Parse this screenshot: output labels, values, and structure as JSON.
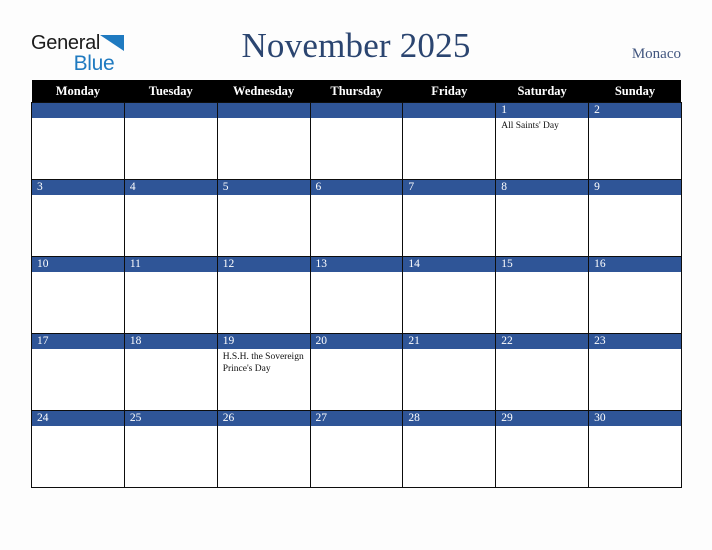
{
  "brand": {
    "name_part1": "General",
    "name_part2": "Blue",
    "triangle_icon": "blue-triangle-icon"
  },
  "header": {
    "title": "November 2025",
    "country": "Monaco"
  },
  "colors": {
    "header_row_bg": "#000000",
    "date_band_bg": "#2f5597",
    "title_text": "#2b4570",
    "country_text": "#42567f",
    "brand_blue": "#1f7ac0",
    "page_bg": "#fdfdfd",
    "cell_bg": "#ffffff",
    "cell_border": "#0d0d0d"
  },
  "calendar": {
    "weekday_headers": [
      "Monday",
      "Tuesday",
      "Wednesday",
      "Thursday",
      "Friday",
      "Saturday",
      "Sunday"
    ],
    "weeks": [
      [
        {
          "day": "",
          "event": ""
        },
        {
          "day": "",
          "event": ""
        },
        {
          "day": "",
          "event": ""
        },
        {
          "day": "",
          "event": ""
        },
        {
          "day": "",
          "event": ""
        },
        {
          "day": "1",
          "event": "All Saints' Day"
        },
        {
          "day": "2",
          "event": ""
        }
      ],
      [
        {
          "day": "3",
          "event": ""
        },
        {
          "day": "4",
          "event": ""
        },
        {
          "day": "5",
          "event": ""
        },
        {
          "day": "6",
          "event": ""
        },
        {
          "day": "7",
          "event": ""
        },
        {
          "day": "8",
          "event": ""
        },
        {
          "day": "9",
          "event": ""
        }
      ],
      [
        {
          "day": "10",
          "event": ""
        },
        {
          "day": "11",
          "event": ""
        },
        {
          "day": "12",
          "event": ""
        },
        {
          "day": "13",
          "event": ""
        },
        {
          "day": "14",
          "event": ""
        },
        {
          "day": "15",
          "event": ""
        },
        {
          "day": "16",
          "event": ""
        }
      ],
      [
        {
          "day": "17",
          "event": ""
        },
        {
          "day": "18",
          "event": ""
        },
        {
          "day": "19",
          "event": "H.S.H. the Sovereign Prince's Day"
        },
        {
          "day": "20",
          "event": ""
        },
        {
          "day": "21",
          "event": ""
        },
        {
          "day": "22",
          "event": ""
        },
        {
          "day": "23",
          "event": ""
        }
      ],
      [
        {
          "day": "24",
          "event": ""
        },
        {
          "day": "25",
          "event": ""
        },
        {
          "day": "26",
          "event": ""
        },
        {
          "day": "27",
          "event": ""
        },
        {
          "day": "28",
          "event": ""
        },
        {
          "day": "29",
          "event": ""
        },
        {
          "day": "30",
          "event": ""
        }
      ]
    ]
  }
}
